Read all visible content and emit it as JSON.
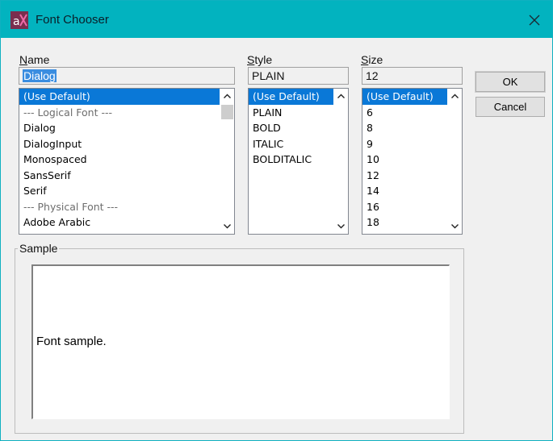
{
  "window": {
    "title": "Font Chooser",
    "app_icon": "app-logo-icon",
    "close_icon": "close-icon"
  },
  "name": {
    "label_mnemonic": "N",
    "label_rest": "ame",
    "value": "Dialog",
    "items": [
      "(Use Default)",
      "--- Logical Font ---",
      "Dialog",
      "DialogInput",
      "Monospaced",
      "SansSerif",
      "Serif",
      "--- Physical Font ---",
      "Adobe Arabic"
    ],
    "selected": "(Use Default)"
  },
  "style": {
    "label_mnemonic": "S",
    "label_rest": "tyle",
    "value": "PLAIN",
    "items": [
      "(Use Default)",
      "PLAIN",
      "BOLD",
      "ITALIC",
      "BOLDITALIC"
    ],
    "selected": "(Use Default)"
  },
  "size": {
    "label_mnemonic": "S",
    "label_rest": "ize",
    "value": "12",
    "items": [
      "(Use Default)",
      "6",
      "8",
      "9",
      "10",
      "12",
      "14",
      "16",
      "18"
    ],
    "selected": "(Use Default)"
  },
  "buttons": {
    "ok": "OK",
    "cancel": "Cancel"
  },
  "sample": {
    "legend": "Sample",
    "text": "Font sample."
  },
  "colors": {
    "titlebar": "#02b3bf",
    "selection": "#0a78d7"
  }
}
